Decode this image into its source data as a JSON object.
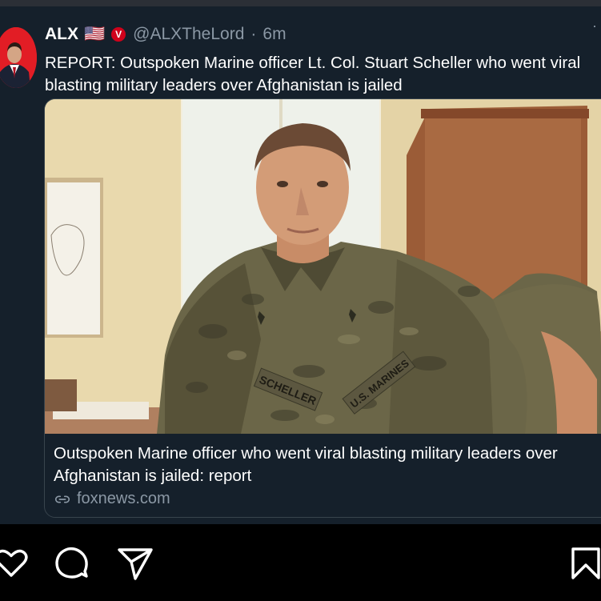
{
  "tweet": {
    "display_name": "ALX",
    "flag_icon": "us-flag-emoji",
    "flag": "🇺🇸",
    "badge_icon": "verified-v-badge",
    "badge_letter": "V",
    "handle": "@ALXTheLord",
    "separator": "·",
    "time": "6m",
    "more_icon": "more-icon",
    "text": "REPORT: Outspoken Marine officer Lt. Col. Stuart Scheller who went viral blasting military leaders over Afghanistan is jailed"
  },
  "card": {
    "image_label": "Marine officer in camouflage uniform seated in an office",
    "name_tape_left": "SCHELLER",
    "name_tape_right": "U.S. MARINES",
    "title": "Outspoken Marine officer who went viral blasting military leaders over Afghanistan is jailed: report",
    "link_icon": "link-icon",
    "domain": "foxnews.com"
  },
  "actions": {
    "like_icon": "heart-icon",
    "comment_icon": "comment-icon",
    "share_icon": "send-icon",
    "save_icon": "bookmark-icon"
  },
  "colors": {
    "tweet_bg": "#15202b",
    "card_border": "#38444d",
    "muted_text": "#8b98a5",
    "badge_red": "#d0021b",
    "app_bg": "#000000"
  }
}
